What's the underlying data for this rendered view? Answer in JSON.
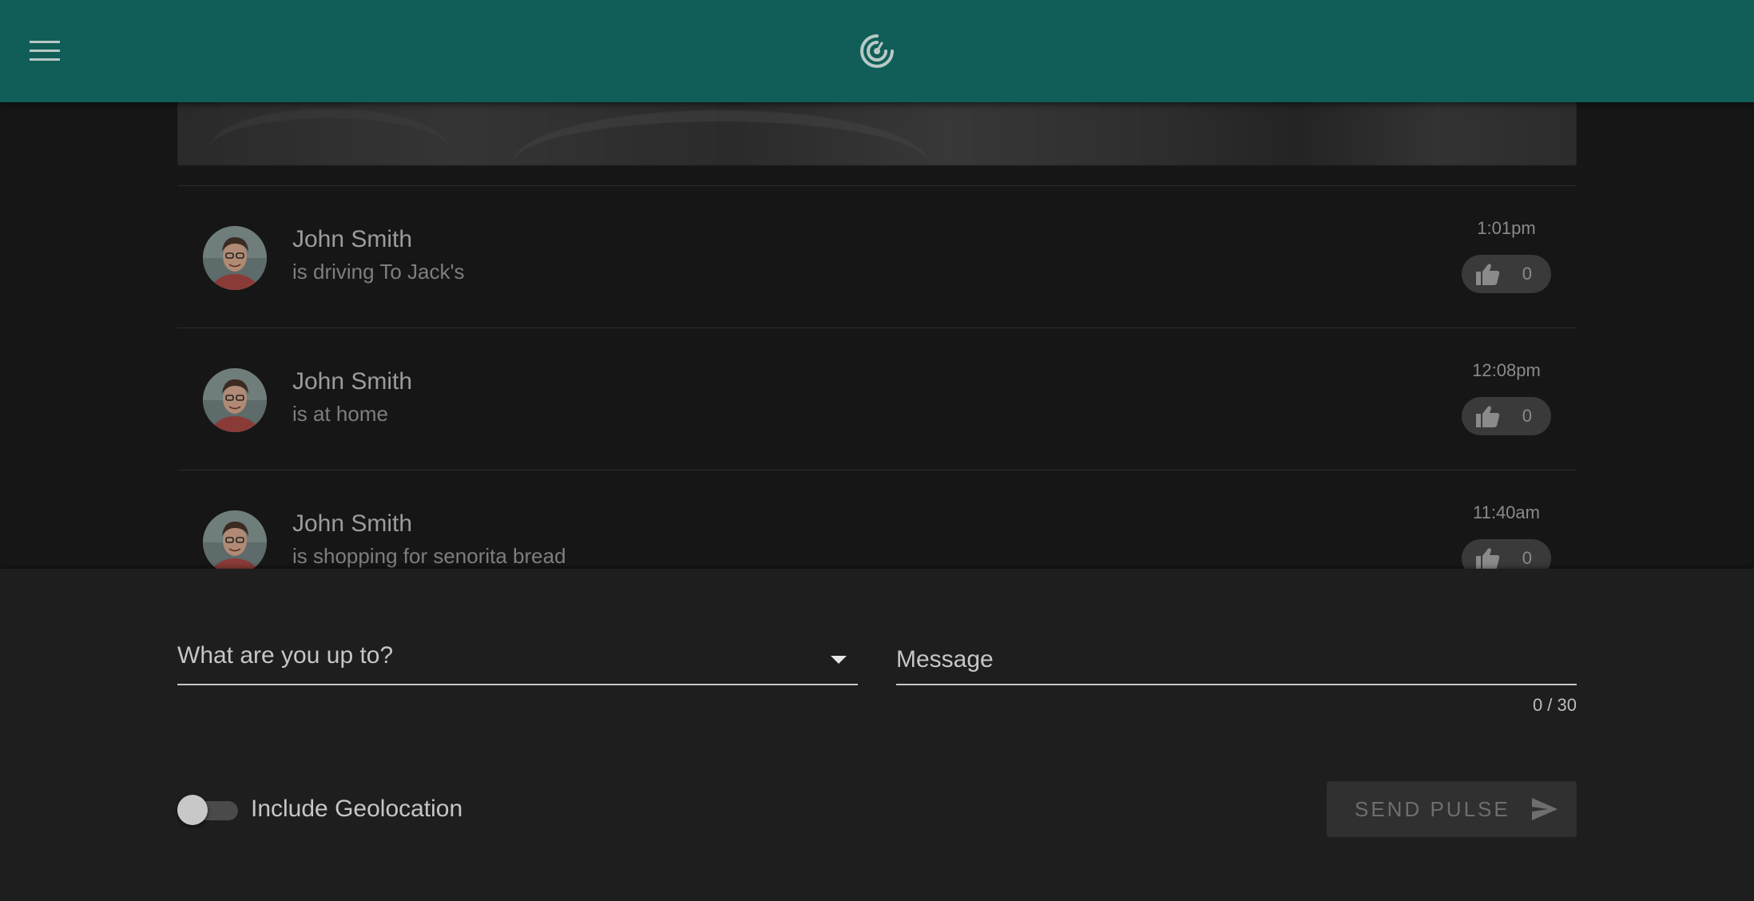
{
  "header": {
    "menu_icon": "hamburger-menu-icon",
    "logo_icon": "radar-pulse-logo-icon",
    "color": "#115e58"
  },
  "feed": {
    "items": [
      {
        "name": "John Smith",
        "status": "is driving To Jack's",
        "time": "1:01pm",
        "likes": "0"
      },
      {
        "name": "John Smith",
        "status": "is at home",
        "time": "12:08pm",
        "likes": "0"
      },
      {
        "name": "John Smith",
        "status": "is shopping for senorita bread",
        "time": "11:40am",
        "likes": "0"
      }
    ]
  },
  "composer": {
    "activity_select": {
      "placeholder": "What are you up to?"
    },
    "message": {
      "placeholder": "Message",
      "value": "",
      "counter": "0 / 30"
    },
    "geolocation": {
      "label": "Include Geolocation",
      "enabled": false
    },
    "send_button": {
      "label": "SEND PULSE",
      "icon": "send-icon"
    }
  }
}
